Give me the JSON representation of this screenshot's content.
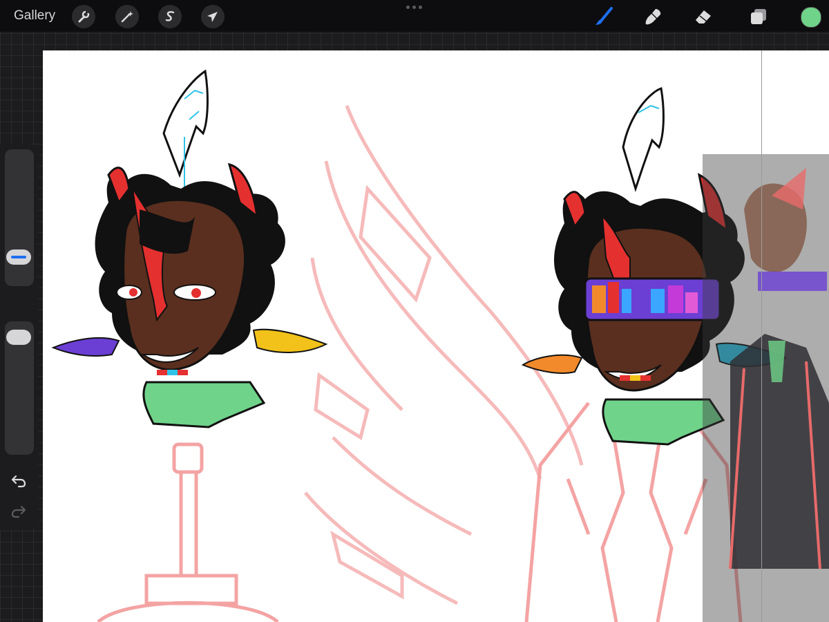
{
  "toolbar": {
    "gallery_label": "Gallery",
    "left_tools": [
      "wrench-icon",
      "magic-wand-icon",
      "selection-s-icon",
      "transform-arrow-icon"
    ],
    "right_tools": [
      "brush-icon",
      "smudge-icon",
      "eraser-icon",
      "layers-icon"
    ],
    "active_tool": "brush-icon",
    "accent_color": "#1e6ff1",
    "current_color": "#6fd38a"
  },
  "sidebar": {
    "controls": [
      "brush-size-slider",
      "modify-button",
      "opacity-slider",
      "undo-icon",
      "redo-icon"
    ]
  },
  "canvas": {
    "background": "#ffffff",
    "sketch_color": "#f4a3a3",
    "artwork": [
      "character-headshot-left",
      "character-headshot-sunglasses",
      "reference-image-panel"
    ]
  }
}
